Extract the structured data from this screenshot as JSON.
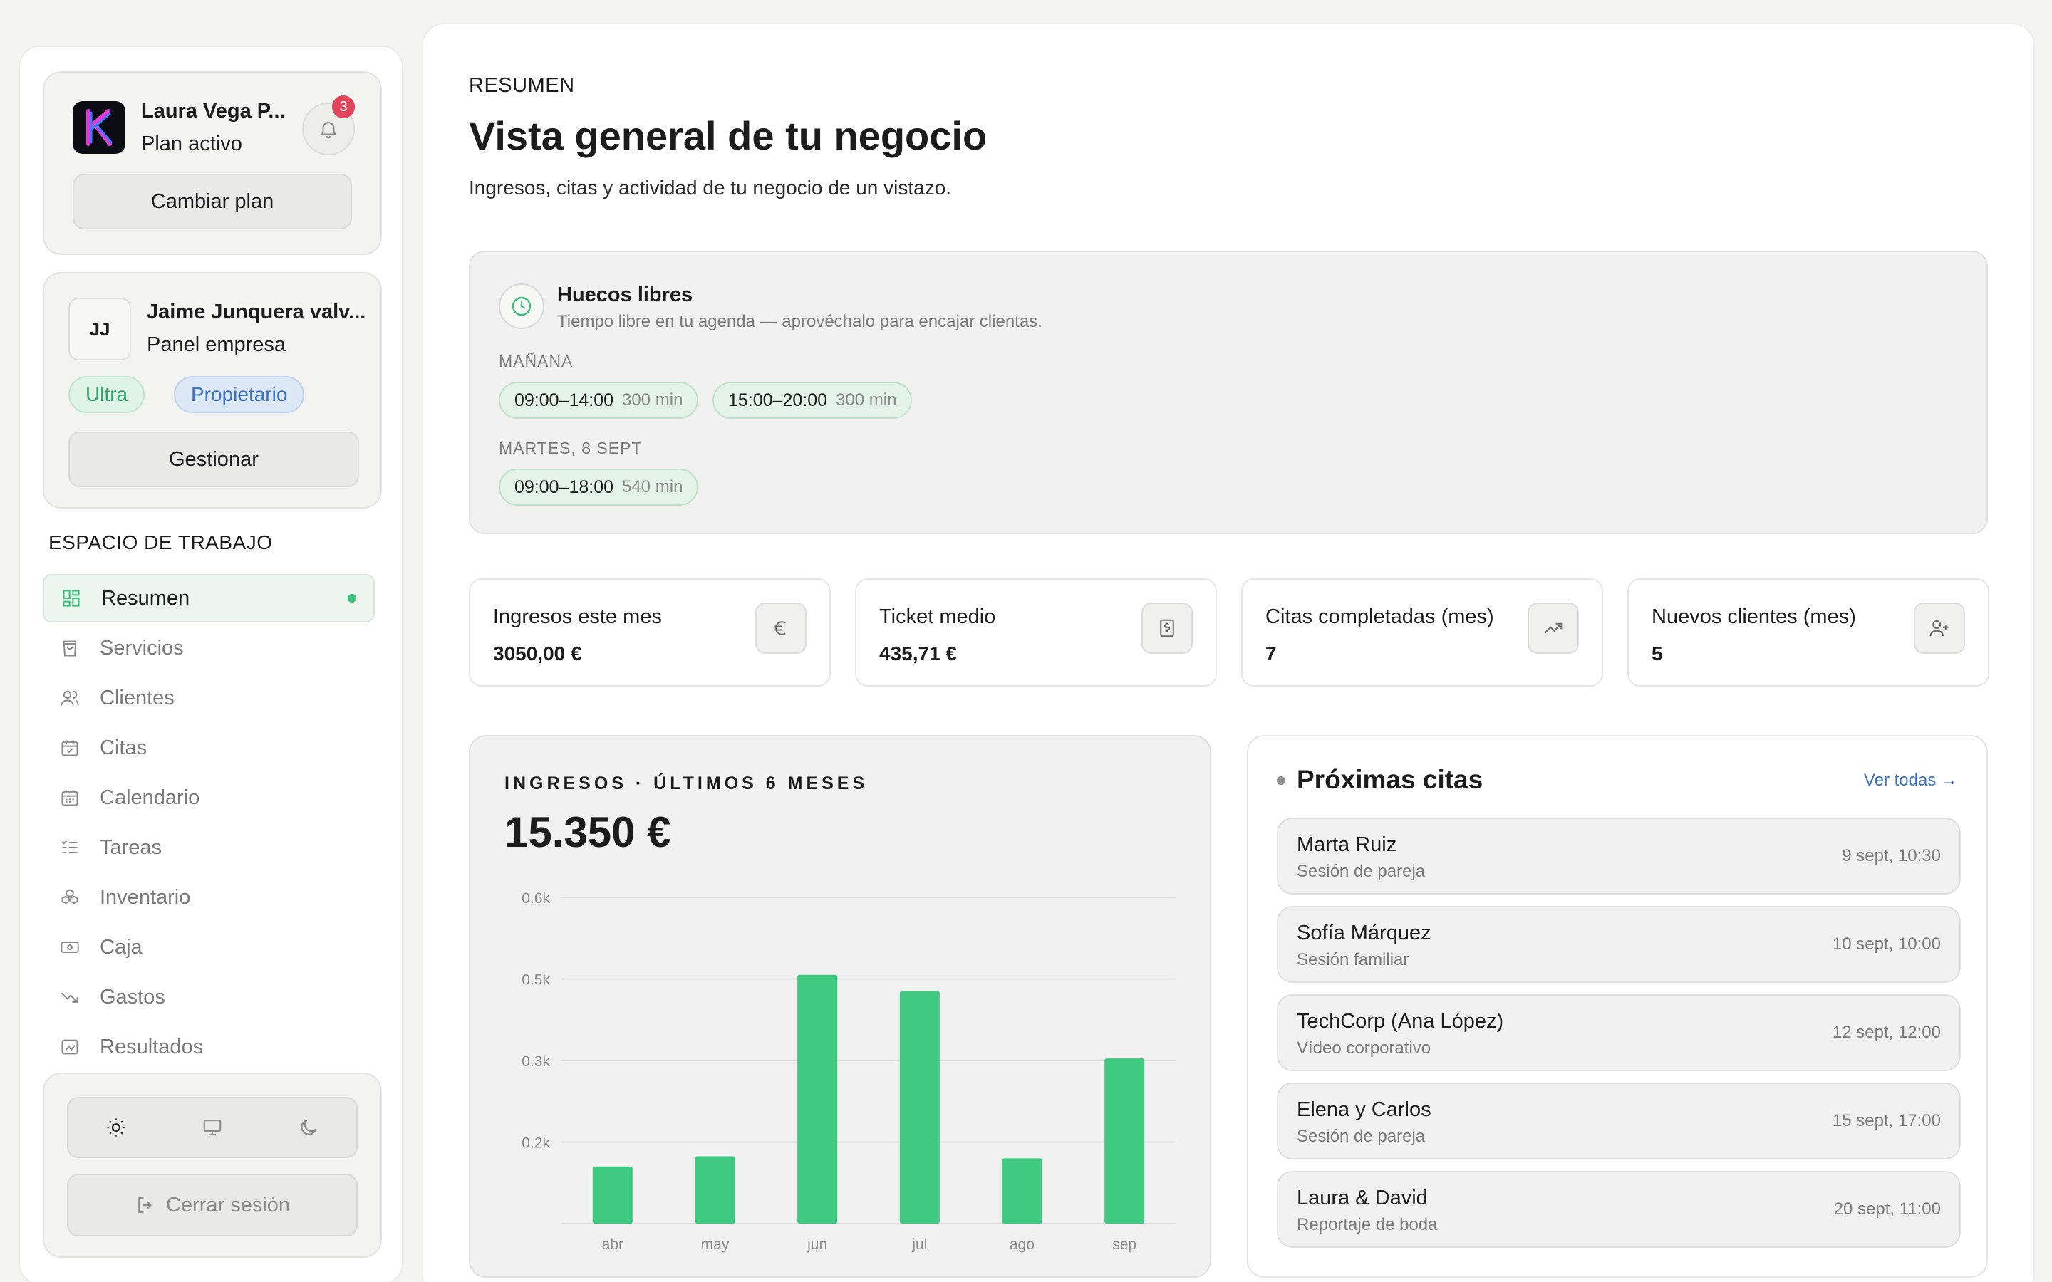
{
  "sidebar": {
    "plan": {
      "name": "Laura Vega P...",
      "status": "Plan activo",
      "notifications": "3",
      "change_plan": "Cambiar plan"
    },
    "user": {
      "initials": "JJ",
      "name": "Jaime Junquera valv...",
      "role": "Panel empresa",
      "badges": [
        "Ultra",
        "Propietario"
      ],
      "manage": "Gestionar"
    },
    "workspace_title": "ESPACIO DE TRABAJO",
    "items": [
      {
        "label": "Resumen",
        "icon": "grid-icon",
        "active": true
      },
      {
        "label": "Servicios",
        "icon": "bag-icon"
      },
      {
        "label": "Clientes",
        "icon": "users-icon"
      },
      {
        "label": "Citas",
        "icon": "calendar-check-icon"
      },
      {
        "label": "Calendario",
        "icon": "calendar-icon"
      },
      {
        "label": "Tareas",
        "icon": "checklist-icon"
      },
      {
        "label": "Inventario",
        "icon": "boxes-icon"
      },
      {
        "label": "Caja",
        "icon": "cash-icon"
      },
      {
        "label": "Gastos",
        "icon": "trend-down-icon"
      },
      {
        "label": "Resultados",
        "icon": "chart-box-icon"
      }
    ],
    "logout": "Cerrar sesión"
  },
  "header": {
    "eyebrow": "RESUMEN",
    "title": "Vista general de tu negocio",
    "subtitle": "Ingresos, citas y actividad de tu negocio de un vistazo."
  },
  "slots": {
    "title": "Huecos libres",
    "subtitle": "Tiempo libre en tu agenda — aprovéchalo para encajar clientas.",
    "days": [
      {
        "label": "MAÑANA",
        "chips": [
          {
            "range": "09:00–14:00",
            "dur": "300 min"
          },
          {
            "range": "15:00–20:00",
            "dur": "300 min"
          }
        ]
      },
      {
        "label": "MARTES, 8 SEPT",
        "chips": [
          {
            "range": "09:00–18:00",
            "dur": "540 min"
          }
        ]
      }
    ]
  },
  "stats": [
    {
      "label": "Ingresos este mes",
      "value": "3050,00 €",
      "icon": "euro-icon"
    },
    {
      "label": "Ticket medio",
      "value": "435,71 €",
      "icon": "receipt-icon"
    },
    {
      "label": "Citas completadas (mes)",
      "value": "7",
      "icon": "trend-up-icon"
    },
    {
      "label": "Nuevos clientes (mes)",
      "value": "5",
      "icon": "user-plus-icon"
    }
  ],
  "chart": {
    "title": "INGRESOS · ÚLTIMOS 6 MESES",
    "total": "15.350 €"
  },
  "chart_data": {
    "type": "bar",
    "title": "INGRESOS · ÚLTIMOS 6 MESES",
    "categories": [
      "abr",
      "may",
      "jun",
      "jul",
      "ago",
      "sep"
    ],
    "values": [
      140,
      165,
      610,
      570,
      160,
      405
    ],
    "ytick_labels": [
      "0.2k",
      "0.3k",
      "0.5k",
      "0.6k"
    ],
    "ytick_values": [
      200,
      400,
      600,
      800
    ],
    "ylim": [
      0,
      800
    ],
    "grid": true,
    "color": "#40c981"
  },
  "appointments": {
    "title": "Próximas citas",
    "link": "Ver todas →",
    "items": [
      {
        "name": "Marta Ruiz",
        "type": "Sesión de pareja",
        "time": "9 sept, 10:30"
      },
      {
        "name": "Sofía Márquez",
        "type": "Sesión familiar",
        "time": "10 sept, 10:00"
      },
      {
        "name": "TechCorp (Ana López)",
        "type": "Vídeo corporativo",
        "time": "12 sept, 12:00"
      },
      {
        "name": "Elena y Carlos",
        "type": "Sesión de pareja",
        "time": "15 sept, 17:00"
      },
      {
        "name": "Laura & David",
        "type": "Reportaje de boda",
        "time": "20 sept, 11:00"
      }
    ]
  },
  "colors": {
    "accent": "#40c981",
    "link": "#3d72c2",
    "badge": "#e0455a"
  }
}
